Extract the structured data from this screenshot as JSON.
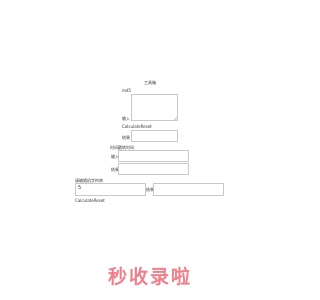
{
  "tool_title": "工具箱",
  "md5": {
    "label": "md5",
    "input_label": "输入",
    "buttons": {
      "calculate": "Calculate",
      "reset": "Reset"
    },
    "result_label": "结果"
  },
  "timestamp": {
    "title": "时间戳转时间",
    "input_label": "输入",
    "result_label": "结果"
  },
  "random_string": {
    "title": "请输随机字符串",
    "input_value": "5",
    "result_label": "结果",
    "buttons": {
      "calculate": "Calculate",
      "reset": "Reset"
    }
  },
  "watermark": "秒收录啦",
  "colors": {
    "border": "#c8c8c8",
    "watermark": "#f07f8c"
  }
}
